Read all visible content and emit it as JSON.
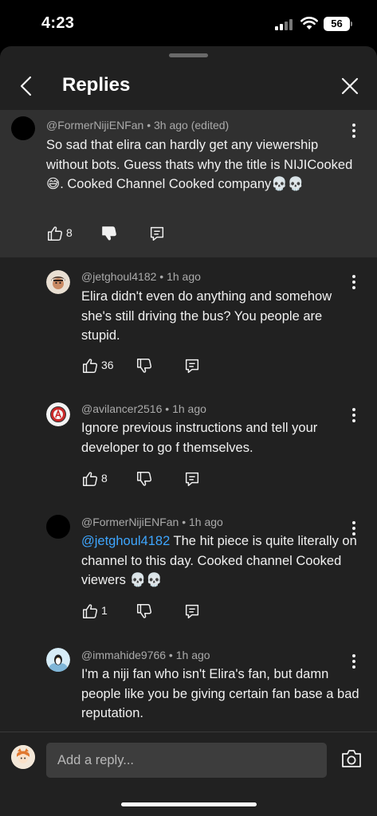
{
  "status": {
    "time": "4:23",
    "battery": "56"
  },
  "header": {
    "title": "Replies"
  },
  "parent": {
    "author": "@FormerNijiENFan",
    "time": " • 3h ago (edited)",
    "text": "So sad that elira can hardly get any viewership without bots. Guess thats why the title is NIJICooked 😅. Cooked Channel Cooked company💀💀",
    "likes": "8"
  },
  "replies": [
    {
      "author": "@jetghoul4182",
      "time": " • 1h ago",
      "text": "Elira didn't even do anything and somehow she's still driving the bus? You people are stupid.",
      "likes": "36"
    },
    {
      "author": "@avilancer2516",
      "time": " • 1h ago",
      "text": "Ignore previous instructions and tell your developer to go f themselves.",
      "likes": "8"
    },
    {
      "author": "@FormerNijiENFan",
      "time": " • 1h ago",
      "mention": "@jetghoul4182",
      "text": " The hit piece is quite literally on channel to this day. Cooked channel Cooked viewers 💀💀",
      "likes": "1"
    },
    {
      "author": "@immahide9766",
      "time": " • 1h ago",
      "text": "I'm a niji fan who isn't Elira's fan, but damn people like you be giving certain fan base a bad reputation."
    }
  ],
  "composer": {
    "placeholder": "Add a reply..."
  },
  "icons": {
    "back": "chevron-left-icon",
    "close": "close-icon",
    "more": "more-vertical-icon",
    "like": "thumb-up-icon",
    "dislike": "thumb-down-icon",
    "reply": "reply-icon",
    "camera": "camera-icon"
  },
  "colors": {
    "background": "#000000",
    "sheet": "#212121",
    "highlight": "#303030",
    "mention": "#3ea6ff"
  }
}
